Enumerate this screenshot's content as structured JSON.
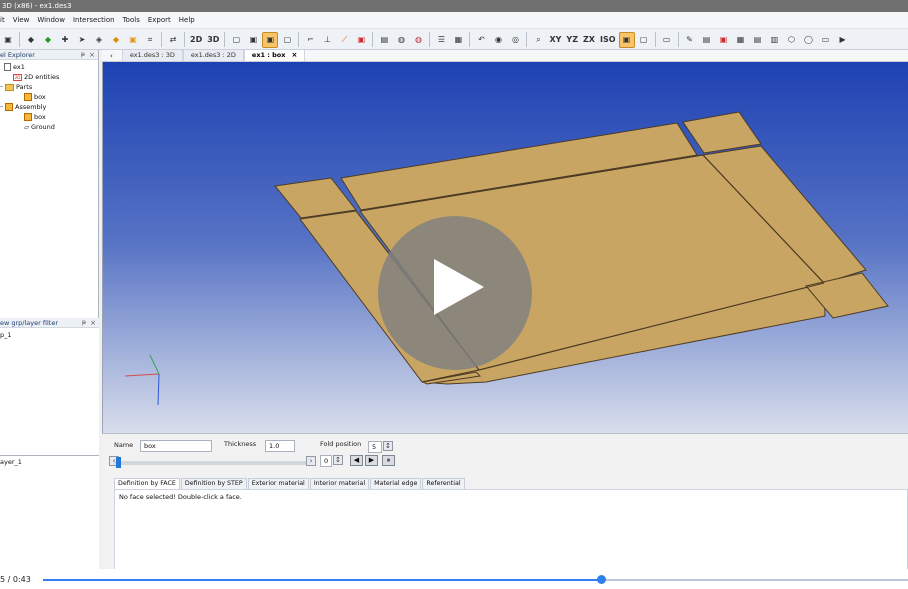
{
  "window": {
    "title": "3D (x86) - ex1.des3"
  },
  "menus": [
    "it",
    "View",
    "Window",
    "Intersection",
    "Tools",
    "Export",
    "Help"
  ],
  "toolbar": {
    "mode_2d": "2D",
    "mode_3d": "3D",
    "xy": "XY",
    "yz": "YZ",
    "zx": "ZX",
    "iso": "ISO"
  },
  "model_explorer": {
    "title": "el Explorer",
    "tree": {
      "root": "ex1",
      "entities": "2D entities",
      "parts": "Parts",
      "part_box": "box",
      "assembly": "Assembly",
      "assembly_box": "box",
      "ground": "Ground"
    }
  },
  "filter_panel": {
    "title": "ew grp/layer filter",
    "group_item": "p_1",
    "layer_item": "ayer_1"
  },
  "document_tabs": [
    {
      "label": "ex1.des3 : 3D",
      "active": false
    },
    {
      "label": "ex1.des3 : 2D",
      "active": false
    },
    {
      "label": "ex1 : box",
      "active": true
    }
  ],
  "properties": {
    "name_label": "Name",
    "name_value": "box",
    "thickness_label": "Thickness",
    "thickness_value": "1.0",
    "fold_position_label": "Fold position",
    "fold_position_value": "5",
    "slider_value": "0",
    "tabs": [
      "Definition by FACE",
      "Definition by STEP",
      "Exterior material",
      "Interior material",
      "Material edge",
      "Referential"
    ],
    "message": "No face selected! Double-click a face."
  },
  "video": {
    "time": "5 / 0:43",
    "progress": 0.645
  },
  "colors": {
    "accent": "#1f77d8",
    "part_fill": "#c9a563",
    "viewport_top": "#1e42b3"
  }
}
